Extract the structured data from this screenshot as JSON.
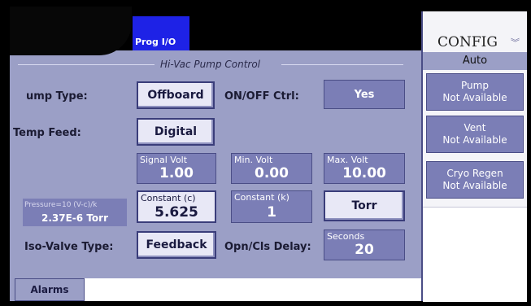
{
  "header": {
    "tab_label": "Prog I/O"
  },
  "section": {
    "title": "Hi-Vac Pump Control"
  },
  "rows": {
    "pump_type_label": "ump Type:",
    "pump_type_value": "Offboard",
    "onoff_label": "ON/OFF Ctrl:",
    "onoff_value": "Yes",
    "temp_feed_label": "Temp Feed:",
    "temp_feed_value": "Digital",
    "iso_valve_label": "Iso-Valve Type:",
    "iso_valve_value": "Feedback",
    "opn_cls_label": "Opn/Cls Delay:"
  },
  "fields": {
    "signal_volt": {
      "caption": "Signal Volt",
      "value": "1.00"
    },
    "min_volt": {
      "caption": "Min. Volt",
      "value": "0.00"
    },
    "max_volt": {
      "caption": "Max. Volt",
      "value": "10.00"
    },
    "constant_c": {
      "caption": "Constant (c)",
      "value": "5.625"
    },
    "constant_k": {
      "caption": "Constant (k)",
      "value": "1"
    },
    "units": "Torr",
    "delay": {
      "caption": "Seconds",
      "value": "20"
    }
  },
  "pressure": {
    "formula": "Pressure=10 (V-c)/k",
    "value": "2.37E-6 Torr"
  },
  "footer": {
    "alarms_label": "Alarms"
  },
  "sidebar": {
    "title": "CONFIG",
    "mode": "Auto",
    "items": [
      {
        "name": "Pump",
        "status": "Not Available"
      },
      {
        "name": "Vent",
        "status": "Not Available"
      },
      {
        "name": "Cryo Regen",
        "status": "Not Available"
      }
    ]
  },
  "icons": {
    "sidebar_collapse": "double-chevron-down-icon"
  },
  "colors": {
    "panel": "#9b9fc6",
    "tab": "#1e22e6",
    "field": "#7b7eb6",
    "button": "#e8e8f6"
  }
}
